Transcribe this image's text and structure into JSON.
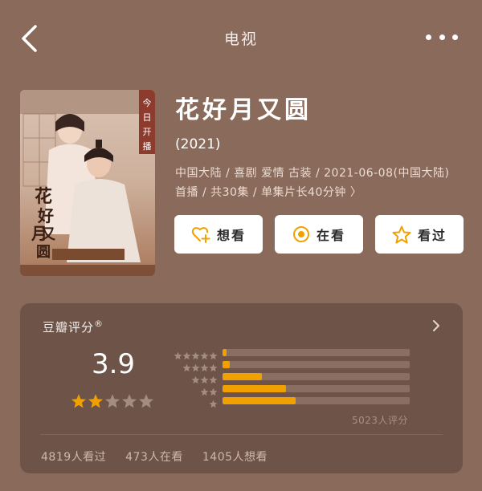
{
  "nav": {
    "title": "电视"
  },
  "movie": {
    "title": "花好月又圆",
    "year": "(2021)",
    "meta": "中国大陆 / 喜剧 爱情 古装 / 2021-06-08(中国大陆)首播 / 共30集 / 单集片长40分钟 〉",
    "poster": {
      "title_art": "花好月又圆",
      "banner": "今日开播"
    }
  },
  "actions": [
    {
      "label": "想看",
      "icon": "heart-plus-icon"
    },
    {
      "label": "在看",
      "icon": "target-icon"
    },
    {
      "label": "看过",
      "icon": "star-outline-icon"
    }
  ],
  "rating": {
    "label": "豆瓣评分",
    "mark": "®",
    "score": "3.9",
    "stars": 2,
    "votes": "5023人评分",
    "distribution": [
      {
        "stars": 5,
        "fraction": 0.02
      },
      {
        "stars": 4,
        "fraction": 0.04
      },
      {
        "stars": 3,
        "fraction": 0.21
      },
      {
        "stars": 2,
        "fraction": 0.34
      },
      {
        "stars": 1,
        "fraction": 0.39
      }
    ]
  },
  "stats": {
    "watched": "4819人看过",
    "watching": "473人在看",
    "want": "1405人想看"
  },
  "colors": {
    "background": "#8a6a5a",
    "card": "#6e5448",
    "accent": "#f0a100",
    "track": "#8a6e62"
  }
}
